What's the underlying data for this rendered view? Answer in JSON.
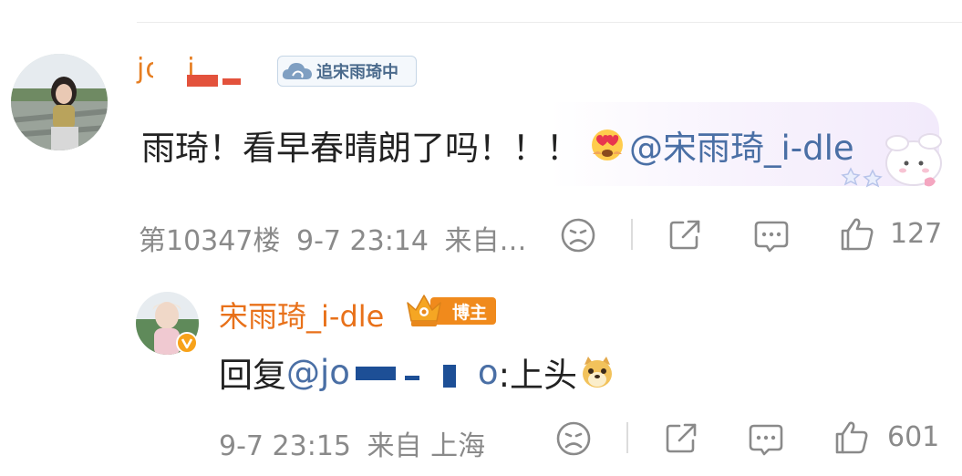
{
  "comment": {
    "username": "jo   _j   o",
    "fan_badge": "追宋雨琦中",
    "text": "雨琦！看早春晴朗了吗！！！",
    "mention": "@宋雨琦_i-dle",
    "floor": "第10347楼",
    "time": "9-7 23:14",
    "location": "来自…",
    "like_count": "127"
  },
  "reply": {
    "username": "宋雨琦_i-dle",
    "author_badge": "博主",
    "reply_prefix": "回复",
    "mention": "@jo",
    "mention_tail": "o",
    "text": ":上头",
    "time": "9-7 23:15",
    "location": "来自 上海",
    "like_count": "601"
  },
  "colors": {
    "username": "#e67e22",
    "mention": "#4a6fa5",
    "meta": "#8a8a8a",
    "author_badge": "#f08a1c"
  }
}
